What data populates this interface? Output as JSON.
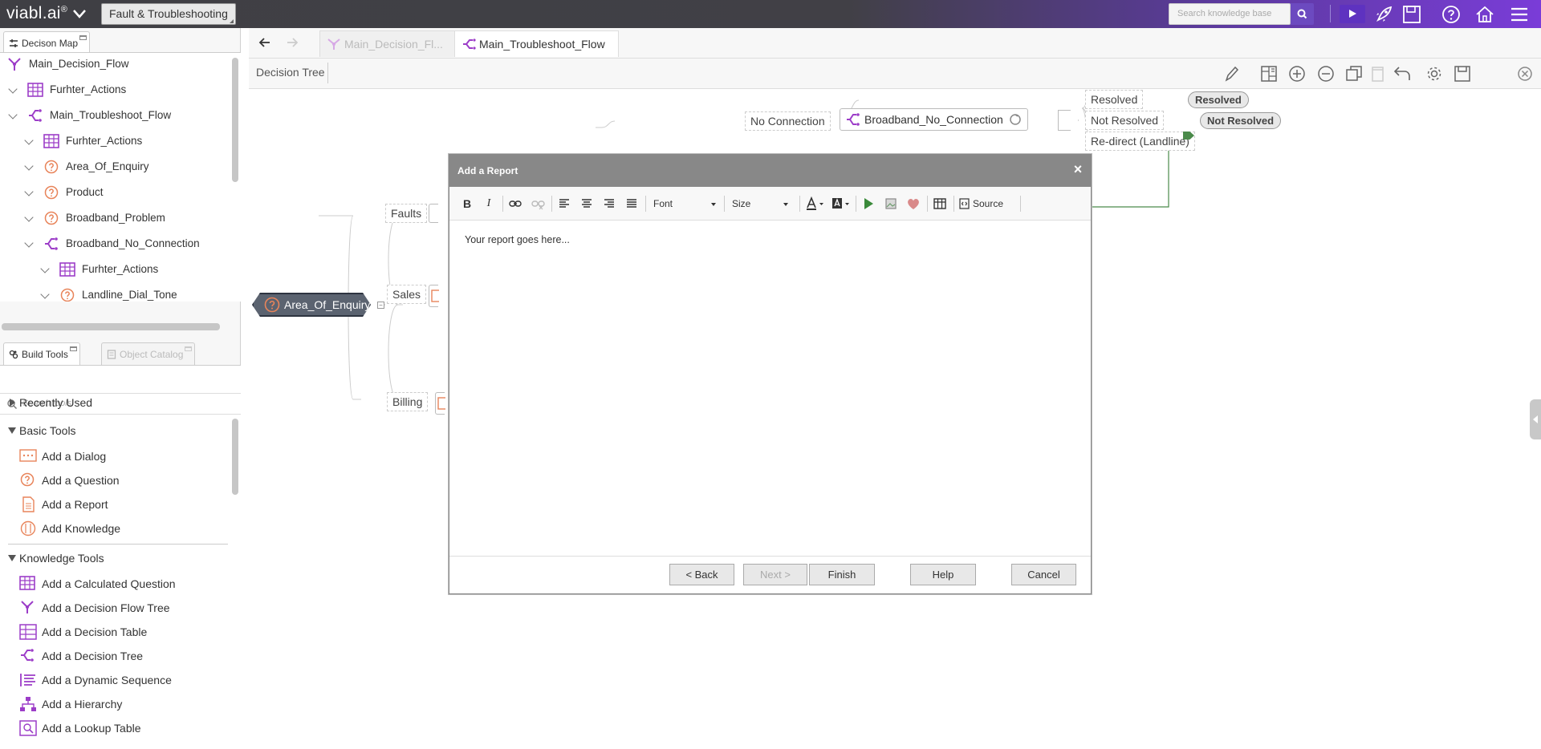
{
  "header": {
    "logo": "viabl.ai",
    "logo_mark": "®",
    "kb_name": "Fault & Troubleshooting",
    "search_placeholder": "Search knowledge base"
  },
  "left_panel": {
    "decision_map_tab": "Decison Map",
    "tree": [
      {
        "label": "Main_Decision_Flow",
        "icon": "decision-flow-icon",
        "indent": 0,
        "chevron": false
      },
      {
        "label": "Furhter_Actions",
        "icon": "calculated-question-icon",
        "indent": 1,
        "chevron": true
      },
      {
        "label": "Main_Troubleshoot_Flow",
        "icon": "decision-tree-icon",
        "indent": 1,
        "chevron": true
      },
      {
        "label": "Furhter_Actions",
        "icon": "calculated-question-icon",
        "indent": 2,
        "chevron": true
      },
      {
        "label": "Area_Of_Enquiry",
        "icon": "question-icon",
        "indent": 2,
        "chevron": true
      },
      {
        "label": "Product",
        "icon": "question-icon",
        "indent": 2,
        "chevron": true
      },
      {
        "label": "Broadband_Problem",
        "icon": "question-icon",
        "indent": 2,
        "chevron": true
      },
      {
        "label": "Broadband_No_Connection",
        "icon": "decision-tree-icon",
        "indent": 2,
        "chevron": true
      },
      {
        "label": "Furhter_Actions",
        "icon": "calculated-question-icon",
        "indent": 3,
        "chevron": true
      },
      {
        "label": "Landline_Dial_Tone",
        "icon": "question-icon",
        "indent": 3,
        "chevron": true
      }
    ],
    "build_tools_tab": "Build Tools",
    "object_catalog_tab": "Object Catalog",
    "tools_search_placeholder": "Search tools",
    "sections": {
      "recently_used": "Recently Used",
      "basic_tools": "Basic Tools",
      "knowledge_tools": "Knowledge Tools"
    },
    "basic_tools": [
      "Add a Dialog",
      "Add a Question",
      "Add a Report",
      "Add Knowledge"
    ],
    "knowledge_tools": [
      "Add a Calculated Question",
      "Add a Decision Flow Tree",
      "Add a Decision Table",
      "Add a Decision Tree",
      "Add a Dynamic Sequence",
      "Add a Hierarchy",
      "Add a Lookup Table"
    ]
  },
  "main": {
    "tabs": [
      {
        "label": "Main_Decision_Fl...",
        "active": false
      },
      {
        "label": "Main_Troubleshoot_Flow",
        "active": true
      }
    ],
    "view_label": "Decision Tree",
    "canvas": {
      "root": "Area_Of_Enquiry",
      "branches": [
        "Faults",
        "Sales",
        "Billing"
      ],
      "no_connection": "No Connection",
      "sub_node": "Broadband_No_Connection",
      "outcomes": [
        {
          "label": "Resolved",
          "pill": "Resolved"
        },
        {
          "label": "Not Resolved",
          "pill": "Not Resolved"
        },
        {
          "label": "Re-direct (Landline)",
          "pill": ""
        }
      ]
    }
  },
  "modal": {
    "title": "Add a Report",
    "close": "×",
    "toolbar": {
      "bold": "B",
      "italic": "I",
      "font": "Font",
      "size": "Size",
      "source": "Source"
    },
    "body_text": "Your report goes here...",
    "buttons": {
      "back": "< Back",
      "next": "Next >",
      "finish": "Finish",
      "help": "Help",
      "cancel": "Cancel"
    }
  },
  "colors": {
    "accent_purple": "#7a3cd8",
    "icon_purple": "#9c3dc8",
    "icon_orange": "#e8845a",
    "modal_header": "#888888",
    "root_node": "#5b6370",
    "connector_green": "#4a8a4a"
  }
}
